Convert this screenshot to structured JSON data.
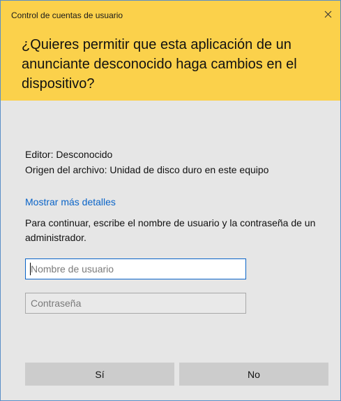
{
  "window": {
    "title": "Control de cuentas de usuario",
    "close_icon": "close-icon"
  },
  "prompt": {
    "question": "¿Quieres permitir que esta aplicación de un anunciante desconocido haga cambios en el dispositivo?"
  },
  "info": {
    "publisher": "Editor: Desconocido",
    "origin": "Origen del archivo: Unidad de disco duro en este equipo",
    "details_link": "Mostrar más detalles",
    "instructions": "Para continuar, escribe el nombre de usuario y la contraseña de un administrador."
  },
  "form": {
    "username_placeholder": "Nombre de usuario",
    "username_value": "",
    "password_placeholder": "Contraseña",
    "password_value": ""
  },
  "buttons": {
    "yes": "Sí",
    "no": "No"
  },
  "colors": {
    "header": "#fbd14b",
    "body": "#e6e6e6",
    "link": "#0a64c8",
    "button": "#cccccc",
    "border": "#5b8fc7"
  }
}
